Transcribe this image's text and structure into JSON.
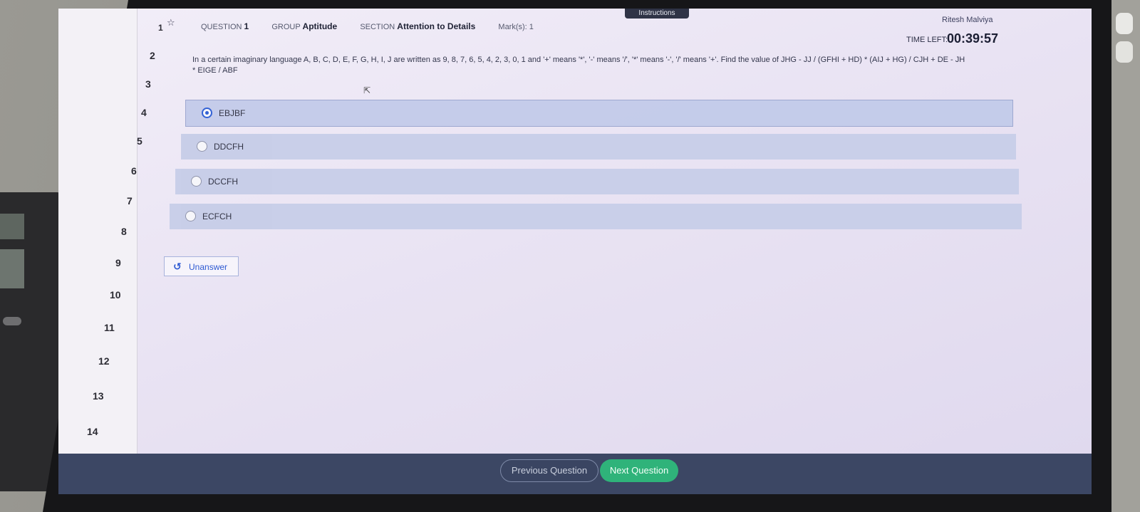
{
  "topbar": {
    "instructions_label": "Instructions"
  },
  "user": {
    "name": "Ritesh Malviya"
  },
  "timer": {
    "label": "TIME LEFT:",
    "value": "00:39:57"
  },
  "question": {
    "question_label": "QUESTION",
    "question_number": "1",
    "group_label": "GROUP",
    "group_value": "Aptitude",
    "section_label": "SECTION",
    "section_value": "Attention to Details",
    "marks": "Mark(s): 1",
    "text_line1": "In a certain imaginary language A, B, C, D, E, F, G, H, I, J are written as 9, 8, 7, 6, 5, 4, 2, 3, 0, 1 and '+' means '*', '-' means '/', '*' means '-', '/' means '+'. Find the value of JHG - JJ / (GFHI + HD) * (AIJ + HG) / CJH + DE - JH",
    "text_line2": "* EIGE / ABF"
  },
  "options": [
    {
      "label": "EBJBF",
      "selected": true
    },
    {
      "label": "DDCFH",
      "selected": false
    },
    {
      "label": "DCCFH",
      "selected": false
    },
    {
      "label": "ECFCH",
      "selected": false
    }
  ],
  "question_nav": {
    "items": [
      "1",
      "2",
      "3",
      "4",
      "5",
      "6",
      "7",
      "8",
      "9",
      "10",
      "11",
      "12",
      "13",
      "14"
    ]
  },
  "unanswer_label": "Unanswer",
  "footer": {
    "prev_label": "Previous Question",
    "next_label": "Next Question"
  },
  "colors": {
    "accent": "#2a5bd4",
    "next": "#2fb37a",
    "footer": "#3c4764"
  },
  "icons": {
    "star": "star-icon",
    "undo": "undo-icon",
    "cursor": "cursor-icon"
  }
}
